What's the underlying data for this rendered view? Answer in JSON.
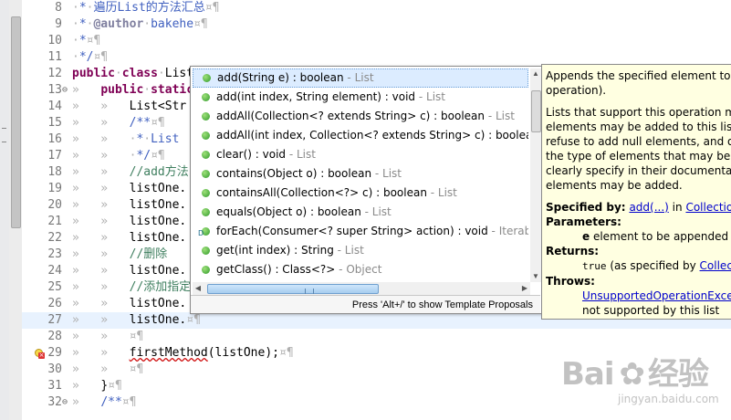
{
  "editor": {
    "lines": [
      {
        "num": "8",
        "fold": "",
        "code_html": "<span class=\"ws\">·</span><span class=\"jd\">*</span><span class=\"ws\">·</span><span class=\"jd\">遍历List的方法汇总</span><span class=\"ws\">¤¶</span>"
      },
      {
        "num": "9",
        "fold": "",
        "code_html": "<span class=\"ws\">·</span><span class=\"jd\">*</span><span class=\"ws\">·</span><span class=\"jd\" style=\"color:#7f7f9f;font-weight:bold\">@author</span><span class=\"ws\">·</span><span class=\"jd\">bakehe</span><span class=\"ws\">¤¶</span>"
      },
      {
        "num": "10",
        "fold": "",
        "code_html": "<span class=\"ws\">·</span><span class=\"jd\">*</span><span class=\"ws\">¤¶</span>"
      },
      {
        "num": "11",
        "fold": "",
        "code_html": "<span class=\"ws\">·</span><span class=\"jd\">*/</span><span class=\"ws\">¤¶</span>"
      },
      {
        "num": "12",
        "fold": "",
        "code_html": "<span class=\"kw\">public</span><span class=\"ws\">·</span><span class=\"kw\">class</span><span class=\"ws\">·</span>List"
      },
      {
        "num": "13",
        "fold": "⊖",
        "code_html": "<span class=\"ws\">»   </span><span class=\"kw\">public</span><span class=\"ws\">·</span><span class=\"kw\">static</span>"
      },
      {
        "num": "14",
        "fold": "",
        "code_html": "<span class=\"ws\">»   »   </span>List&lt;Str"
      },
      {
        "num": "15",
        "fold": "",
        "code_html": "<span class=\"ws\">»   »   </span><span class=\"jd\">/**</span><span class=\"ws\">¤¶</span>"
      },
      {
        "num": "16",
        "fold": "",
        "code_html": "<span class=\"ws\">»   »   </span><span class=\"ws\">·</span><span class=\"jd\">*</span><span class=\"ws\">·</span><span class=\"jd\">List</span>"
      },
      {
        "num": "17",
        "fold": "",
        "code_html": "<span class=\"ws\">»   »   </span><span class=\"ws\">·</span><span class=\"jd\">*/</span><span class=\"ws\">¤¶</span>"
      },
      {
        "num": "18",
        "fold": "",
        "code_html": "<span class=\"ws\">»   »   </span><span class=\"cm\">//add方法</span>"
      },
      {
        "num": "19",
        "fold": "",
        "code_html": "<span class=\"ws\">»   »   </span>listOne."
      },
      {
        "num": "20",
        "fold": "",
        "code_html": "<span class=\"ws\">»   »   </span>listOne."
      },
      {
        "num": "21",
        "fold": "",
        "code_html": "<span class=\"ws\">»   »   </span>listOne."
      },
      {
        "num": "22",
        "fold": "",
        "code_html": "<span class=\"ws\">»   »   </span>listOne."
      },
      {
        "num": "23",
        "fold": "",
        "code_html": "<span class=\"ws\">»   »   </span><span class=\"cm\">//删除</span>"
      },
      {
        "num": "24",
        "fold": "",
        "code_html": "<span class=\"ws\">»   »   </span>listOne."
      },
      {
        "num": "25",
        "fold": "",
        "code_html": "<span class=\"ws\">»   »   </span><span class=\"cm\">//添加指定</span>"
      },
      {
        "num": "26",
        "fold": "",
        "code_html": "<span class=\"ws\">»   »   </span>listOne."
      },
      {
        "num": "27",
        "fold": "",
        "code_html": "<span class=\"ws\">»   »   </span>listOne.<span class=\"ws\">¤¶</span>"
      },
      {
        "num": "28",
        "fold": "",
        "code_html": "<span class=\"ws\">»   »   </span><span class=\"ws\">¤¶</span>"
      },
      {
        "num": "29",
        "fold": "",
        "code_html": "<span class=\"ws\">»   »   </span><span class=\"err-ul\">firstMethod</span>(listOne);<span class=\"ws\">¤¶</span>"
      },
      {
        "num": "30",
        "fold": "",
        "code_html": "<span class=\"ws\">»   »   </span><span class=\"ws\">¤¶</span>"
      },
      {
        "num": "31",
        "fold": "",
        "code_html": "<span class=\"ws\">»   </span>}<span class=\"ws\">¤¶</span>"
      },
      {
        "num": "32",
        "fold": "⊖",
        "code_html": "<span class=\"ws\">»   </span><span class=\"jd\">/**</span><span class=\"ws\">¤¶</span>"
      }
    ],
    "current_line": "27",
    "error_line": "29"
  },
  "completion": {
    "proposals": [
      {
        "sig": "add(String e) : boolean",
        "owner": "List",
        "selected": true,
        "static": false
      },
      {
        "sig": "add(int index, String element) : void",
        "owner": "List",
        "selected": false,
        "static": false
      },
      {
        "sig": "addAll(Collection<? extends String> c) : boolean",
        "owner": "List",
        "selected": false,
        "static": false
      },
      {
        "sig": "addAll(int index, Collection<? extends String> c) : boolean",
        "owner": "",
        "selected": false,
        "static": false
      },
      {
        "sig": "clear() : void",
        "owner": "List",
        "selected": false,
        "static": false
      },
      {
        "sig": "contains(Object o) : boolean",
        "owner": "List",
        "selected": false,
        "static": false
      },
      {
        "sig": "containsAll(Collection<?> c) : boolean",
        "owner": "List",
        "selected": false,
        "static": false
      },
      {
        "sig": "equals(Object o) : boolean",
        "owner": "List",
        "selected": false,
        "static": false
      },
      {
        "sig": "forEach(Consumer<? super String> action) : void",
        "owner": "Iterab",
        "selected": false,
        "static": true
      },
      {
        "sig": "get(int index) : String",
        "owner": "List",
        "selected": false,
        "static": false
      },
      {
        "sig": "getClass() : Class<?>",
        "owner": "Object",
        "selected": false,
        "static": false
      }
    ],
    "footer": "Press 'Alt+/' to show Template Proposals"
  },
  "javadoc": {
    "summary_lines": [
      "Appends the specified element to the",
      "operation)."
    ],
    "detail_lines": [
      "Lists that support this operation may",
      "elements may be added to this list.",
      "refuse to add null elements, and othe",
      "the type of elements that may be ad",
      "clearly specify in their documentatio",
      "elements may be added."
    ],
    "specified_by_label": "Specified by:",
    "specified_by_method": "add(...)",
    "specified_by_in": "in",
    "specified_by_class": "Collection",
    "parameters_label": "Parameters:",
    "param_name": "e",
    "param_desc": "element to be appended to",
    "returns_label": "Returns:",
    "returns_value": "true",
    "returns_desc": "(as specified by",
    "returns_link": "Collec",
    "throws_label": "Throws:",
    "throws_link": "UnsupportedOperationExcep",
    "throws_desc": "not supported by this list"
  },
  "watermark": {
    "brand_left": "Bai",
    "brand_right": "经验",
    "url": "jingyan.baidu.com"
  }
}
